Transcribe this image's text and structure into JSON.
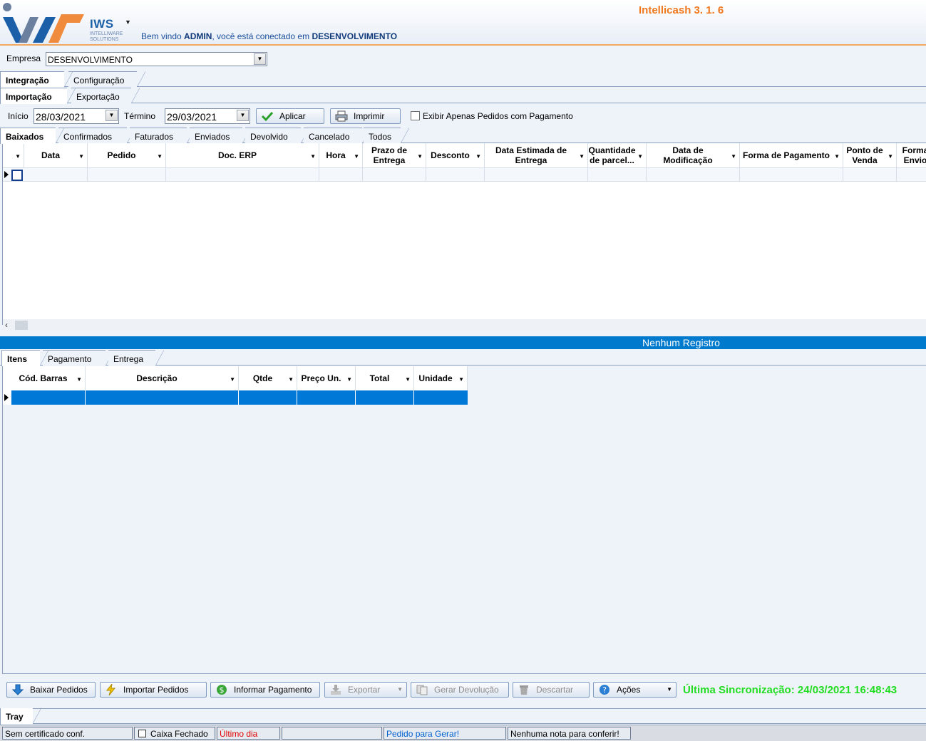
{
  "header": {
    "brand": "IWS",
    "brand_sub1": "INTELLIWARE",
    "brand_sub2": "SOLUTIONS",
    "welcome_prefix": "Bem vindo ",
    "user": "ADMIN",
    "welcome_mid": ", você está conectado em ",
    "environment": "DESENVOLVIMENTO",
    "app_version": "Intellicash 3. 1.  6"
  },
  "empresa": {
    "label": "Empresa",
    "value": "DESENVOLVIMENTO"
  },
  "main_tabs": [
    "Integração",
    "Configuração"
  ],
  "sub_tabs": [
    "Importação",
    "Exportação"
  ],
  "filters": {
    "inicio_label": "Início",
    "inicio_value": "28/03/2021",
    "termino_label": "Término",
    "termino_value": "29/03/2021",
    "aplicar": "Aplicar",
    "imprimir": "Imprimir",
    "exibir_label": "Exibir Apenas Pedidos com Pagamento"
  },
  "status_tabs": [
    "Baixados",
    "Confirmados",
    "Faturados",
    "Enviados",
    "Devolvido",
    "Cancelado",
    "Todos"
  ],
  "orders_grid": {
    "columns": [
      "Data",
      "Pedido",
      "Doc. ERP",
      "Hora",
      "Prazo de Entrega",
      "Desconto",
      "Data Estimada de Entrega",
      "Quantidade de parcel...",
      "Data de Modificação",
      "Forma de Pagamento",
      "Ponto de Venda",
      "Forma Envio"
    ]
  },
  "empty_message": "Nenhum Registro",
  "detail_tabs": [
    "Itens",
    "Pagamento",
    "Entrega"
  ],
  "items_grid": {
    "columns": [
      "Cód. Barras",
      "Descrição",
      "Qtde",
      "Preço Un.",
      "Total",
      "Unidade"
    ]
  },
  "actions": {
    "baixar": "Baixar Pedidos",
    "importar": "Importar Pedidos",
    "informar": "Informar Pagamento",
    "exportar": "Exportar",
    "gerar": "Gerar Devolução",
    "descartar": "Descartar",
    "acoes": "Ações"
  },
  "sync": "Última Sincronização: 24/03/2021 16:48:43",
  "tray_tab": "Tray",
  "status": {
    "certificado": "Sem certificado conf.",
    "caixa": "Caixa Fechado",
    "ultimo_dia": "Último dia",
    "empty": "",
    "pedido_gerar": "Pedido para Gerar!",
    "nota": "Nenhuma nota para conferir!"
  },
  "colors": {
    "accent_blue": "#007acc",
    "orange": "#f0781e",
    "sync_green": "#22dd22",
    "alert_red": "#e00000",
    "link_blue": "#0060d0"
  }
}
